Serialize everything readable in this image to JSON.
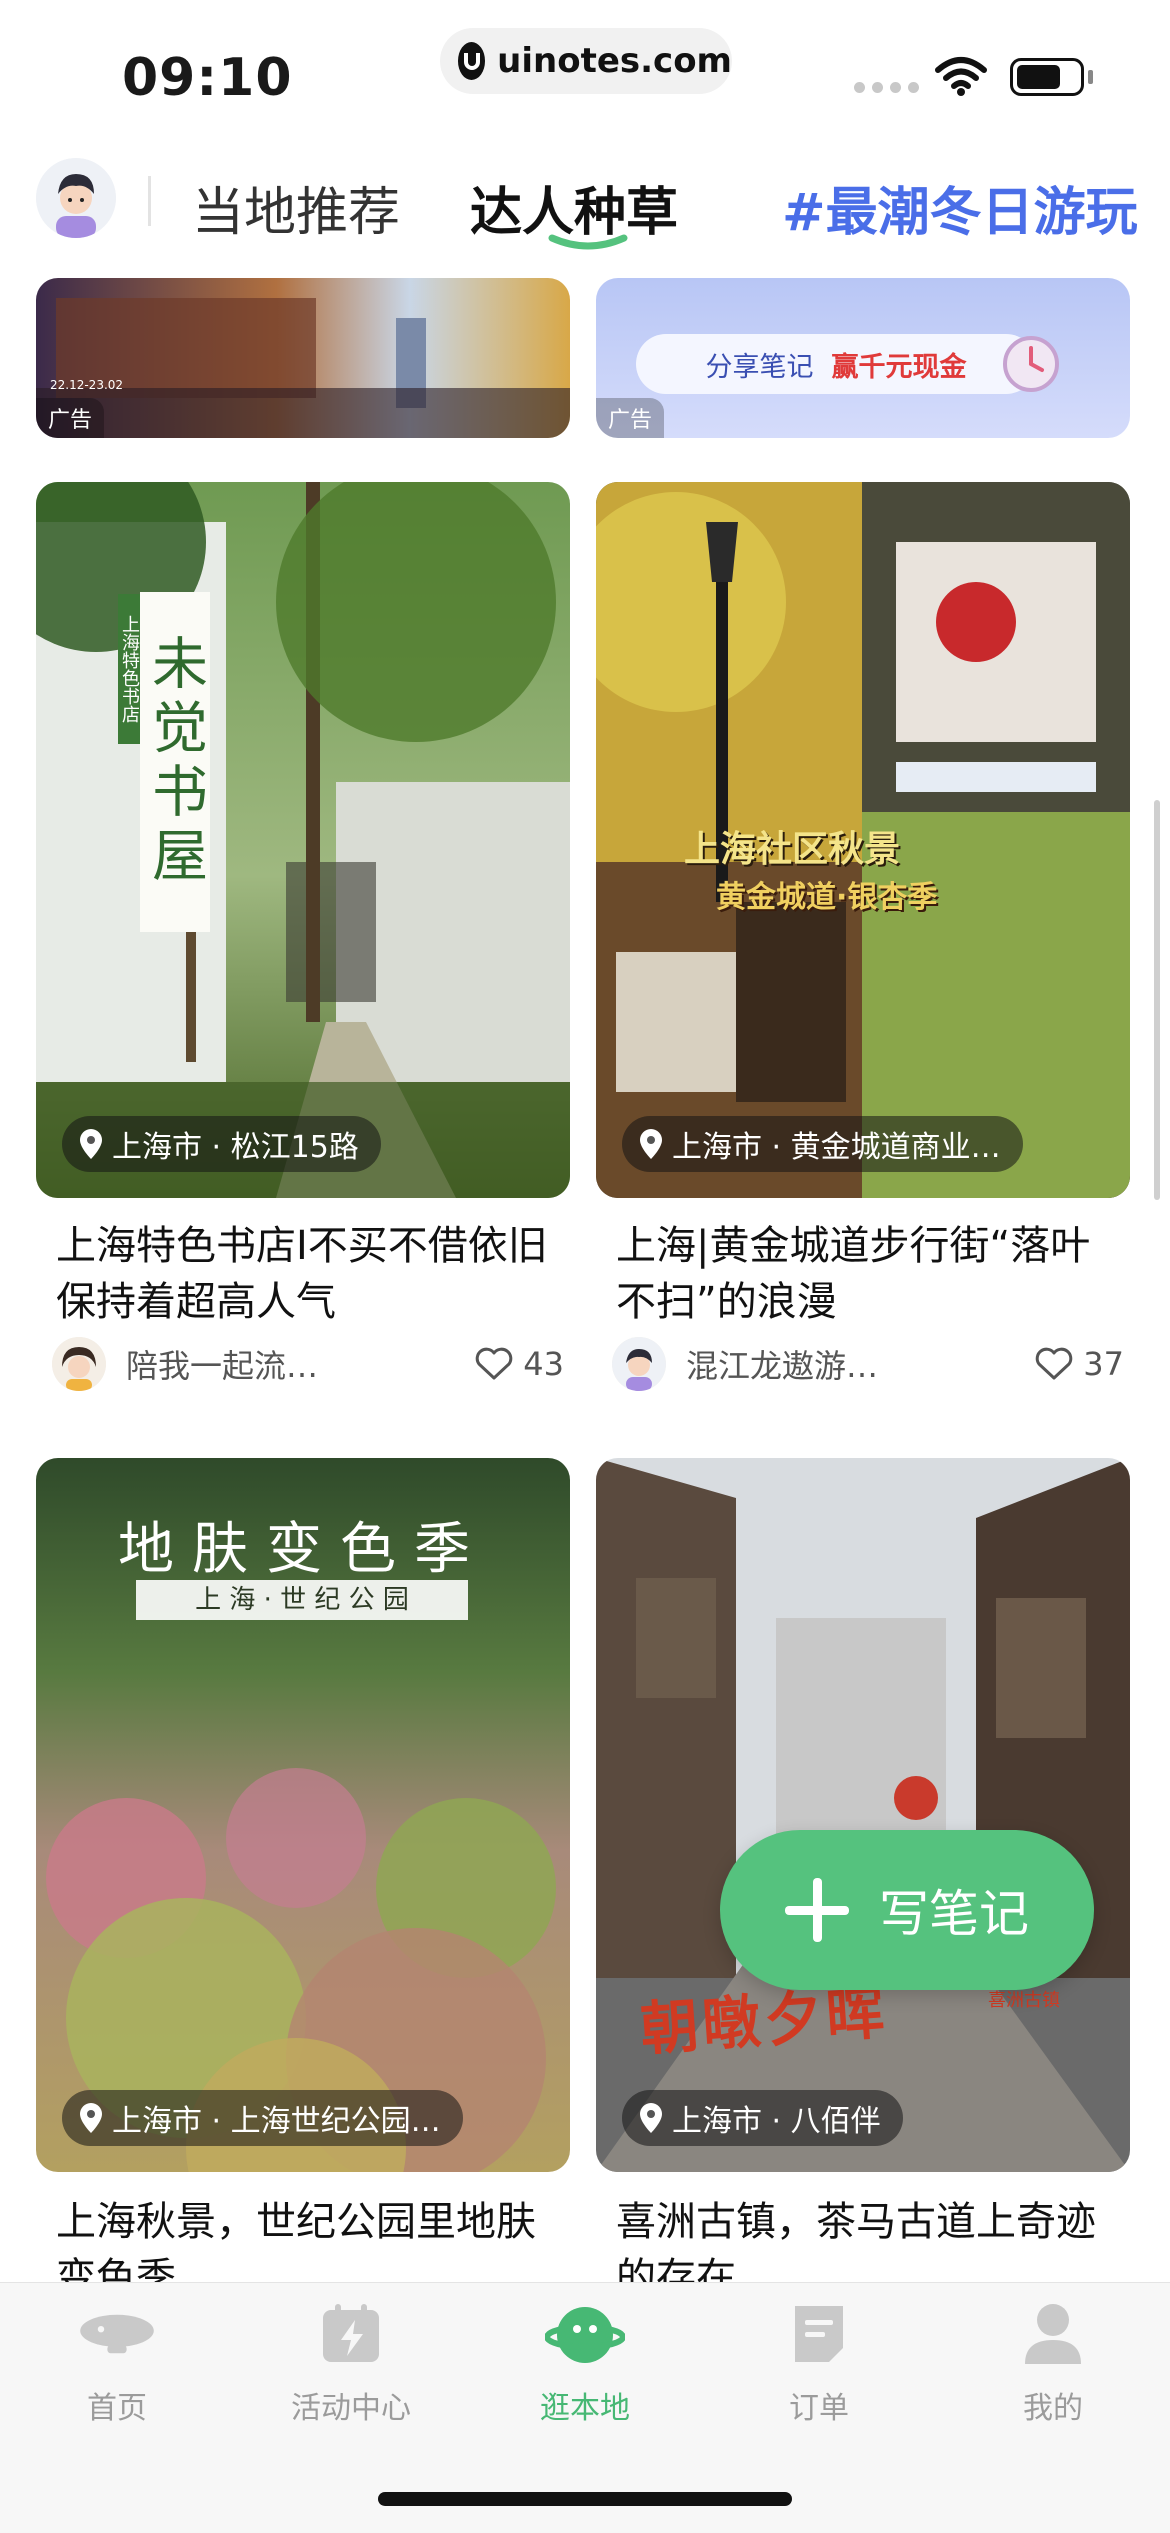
{
  "status_bar": {
    "time": "09:10",
    "url": "uinotes.com"
  },
  "tabs": [
    {
      "label": "当地推荐",
      "active": false
    },
    {
      "label": "达人种草",
      "active": true
    },
    {
      "label": "#最潮冬日游玩",
      "active": false
    }
  ],
  "ads": [
    {
      "label": "广告",
      "image_text": "22.12-23.02"
    },
    {
      "label": "广告",
      "share_text": "分享笔记",
      "reward_text": "赢千元现金"
    }
  ],
  "posts": [
    {
      "location": "上海市 · 松江15路",
      "image_text": "未觉书屋",
      "image_subtext": "上海特色书店",
      "title": "上海特色书店I不买不借依旧保持着超高人气",
      "author": "陪我一起流…",
      "likes": "43"
    },
    {
      "location": "上海市 · 黄金城道商业…",
      "image_text": "上海社区秋景",
      "image_subtext": "黄金城道·银杏季",
      "title": "上海|黄金城道步行街“落叶不扫”的浪漫",
      "author": "混江龙遨游…",
      "likes": "37"
    },
    {
      "location": "上海市 · 上海世纪公园…",
      "image_text": "地肤变色季",
      "image_subtext": "上 海 · 世 纪 公 园",
      "title": "上海秋景，世纪公园里地肤变色季",
      "author": "",
      "likes": ""
    },
    {
      "location": "上海市 · 八佰伴",
      "image_text": "朝暾夕晖",
      "image_subtext": "喜洲古镇",
      "title": "喜洲古镇，茶马古道上奇迹的存在",
      "author": "",
      "likes": ""
    }
  ],
  "fab": {
    "label": "写笔记"
  },
  "bottom_nav": [
    {
      "label": "首页",
      "icon": "airship-icon"
    },
    {
      "label": "活动中心",
      "icon": "calendar-bolt-icon"
    },
    {
      "label": "逛本地",
      "icon": "planet-icon",
      "active": true
    },
    {
      "label": "订单",
      "icon": "order-icon"
    },
    {
      "label": "我的",
      "icon": "user-icon"
    }
  ],
  "colors": {
    "accent": "#55c27e",
    "tag_blue": "#4a6ee8"
  }
}
